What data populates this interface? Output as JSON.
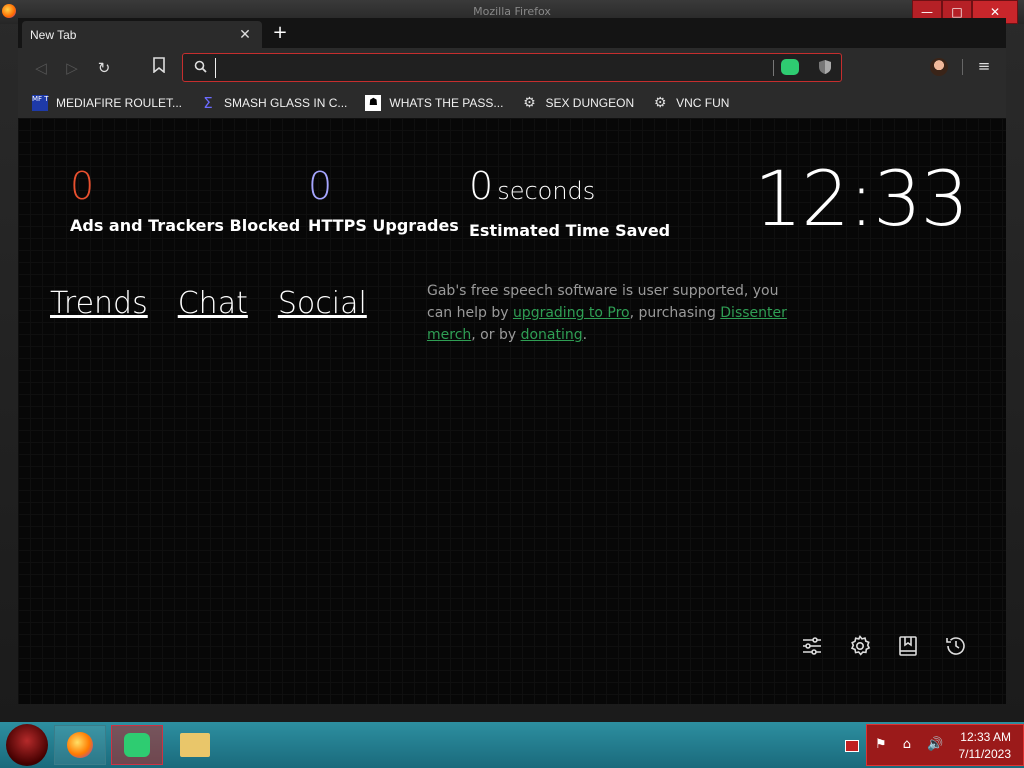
{
  "window": {
    "title": "Mozilla Firefox",
    "minimize": "—",
    "maximize": "□",
    "close": "✕"
  },
  "tab": {
    "title": "New Tab",
    "close": "✕",
    "new_tab": "+"
  },
  "nav": {
    "back": "◁",
    "forward": "▷",
    "reload": "↻",
    "bookmark": "🔖",
    "url_value": "",
    "url_placeholder": "",
    "menu": "≡"
  },
  "bookmarks": [
    {
      "icon": "mediafire-icon",
      "glyph": "MF T",
      "label": "MEDIAFIRE ROULET..."
    },
    {
      "icon": "sigma-icon",
      "glyph": "Σ",
      "label": "SMASH GLASS IN C..."
    },
    {
      "icon": "ghost-icon",
      "glyph": "☗",
      "label": "WHATS THE PASS..."
    },
    {
      "icon": "gear-icon",
      "glyph": "⚙",
      "label": "SEX DUNGEON"
    },
    {
      "icon": "gear-icon",
      "glyph": "⚙",
      "label": "VNC FUN"
    }
  ],
  "stats": {
    "ads": {
      "value": "0",
      "label": "Ads and Trackers Blocked",
      "color": "#e8502f"
    },
    "https": {
      "value": "0",
      "label": "HTTPS Upgrades",
      "color": "#a6a6ff"
    },
    "time": {
      "value": "0",
      "unit": "seconds",
      "label": "Estimated Time Saved",
      "color": "#ffffff"
    }
  },
  "clock": "12:33",
  "links": {
    "trends": "Trends",
    "chat": "Chat",
    "social": "Social"
  },
  "notice": {
    "text1": "Gab's free speech software is user supported, you can help by ",
    "link1": "upgrading to Pro",
    "text2": ", purchasing ",
    "link2": "Dissenter merch",
    "text3": ", or by ",
    "link3": "donating",
    "text4": "."
  },
  "tools": [
    "sliders-icon",
    "gear-icon",
    "bookmarks-icon",
    "history-icon"
  ],
  "taskbar": {
    "time": "12:33 AM",
    "date": "7/11/2023",
    "tray_icons": "⚑ ⌂ 🔊"
  },
  "colors": {
    "accent_red": "#c62e2e",
    "link_green": "#2f9e54",
    "taskbar": "#1a6a7c"
  }
}
